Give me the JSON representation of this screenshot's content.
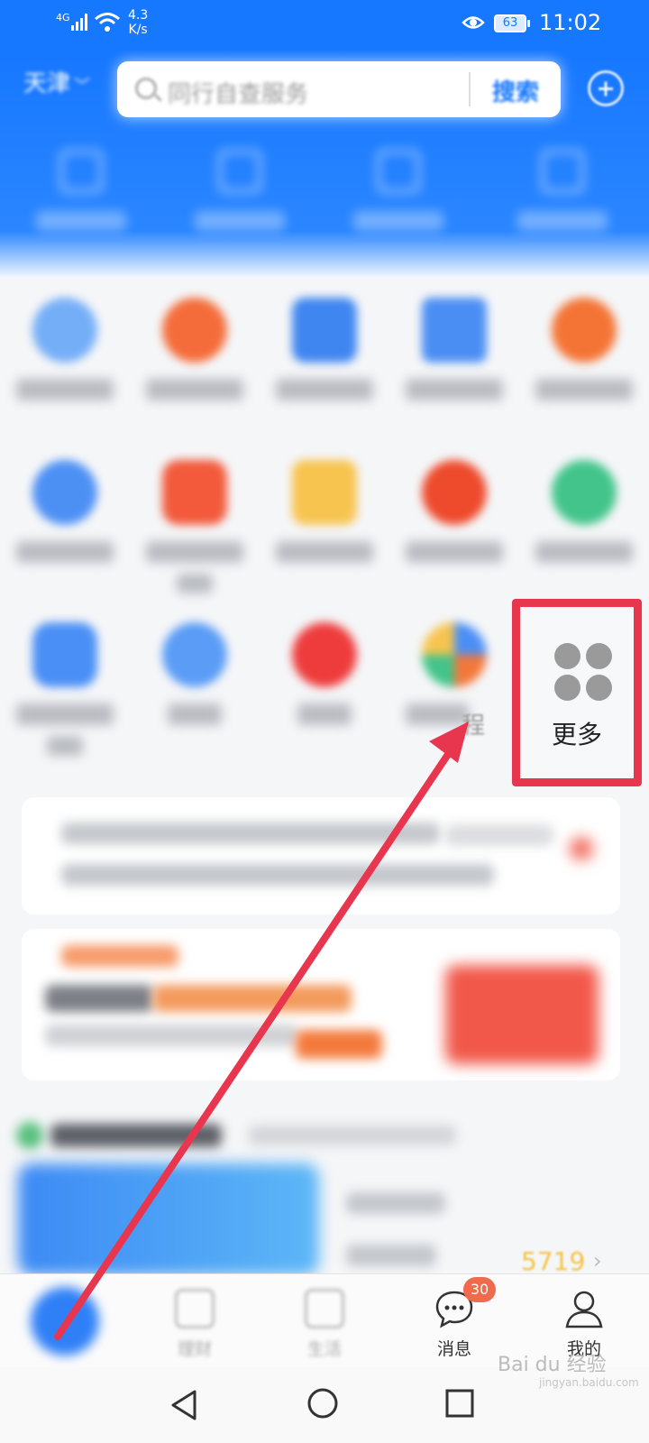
{
  "status_bar": {
    "network": "4G",
    "speed": "4.3\nK/s",
    "battery": "63",
    "time": "11:02"
  },
  "header": {
    "city": "天津",
    "search_placeholder": "同行自查服务",
    "search_button": "搜索"
  },
  "more_button": {
    "label": "更多"
  },
  "partial_label": "程",
  "list_value": "5719",
  "tabbar": {
    "tabs": [
      {
        "label": "",
        "icon": "home-icon"
      },
      {
        "label": "理财",
        "icon": "wealth-icon"
      },
      {
        "label": "生活",
        "icon": "life-icon"
      },
      {
        "label": "消息",
        "icon": "message-icon"
      },
      {
        "label": "我的",
        "icon": "profile-icon"
      }
    ],
    "message_badge": "30"
  },
  "watermark": {
    "main": "Bai du 经验",
    "sub": "jingyan.baidu.com"
  },
  "colors": {
    "brand_blue": "#1677ff",
    "highlight_red": "#e8364f",
    "badge_orange": "#f06a4c",
    "value_yellow": "#f5c342"
  }
}
